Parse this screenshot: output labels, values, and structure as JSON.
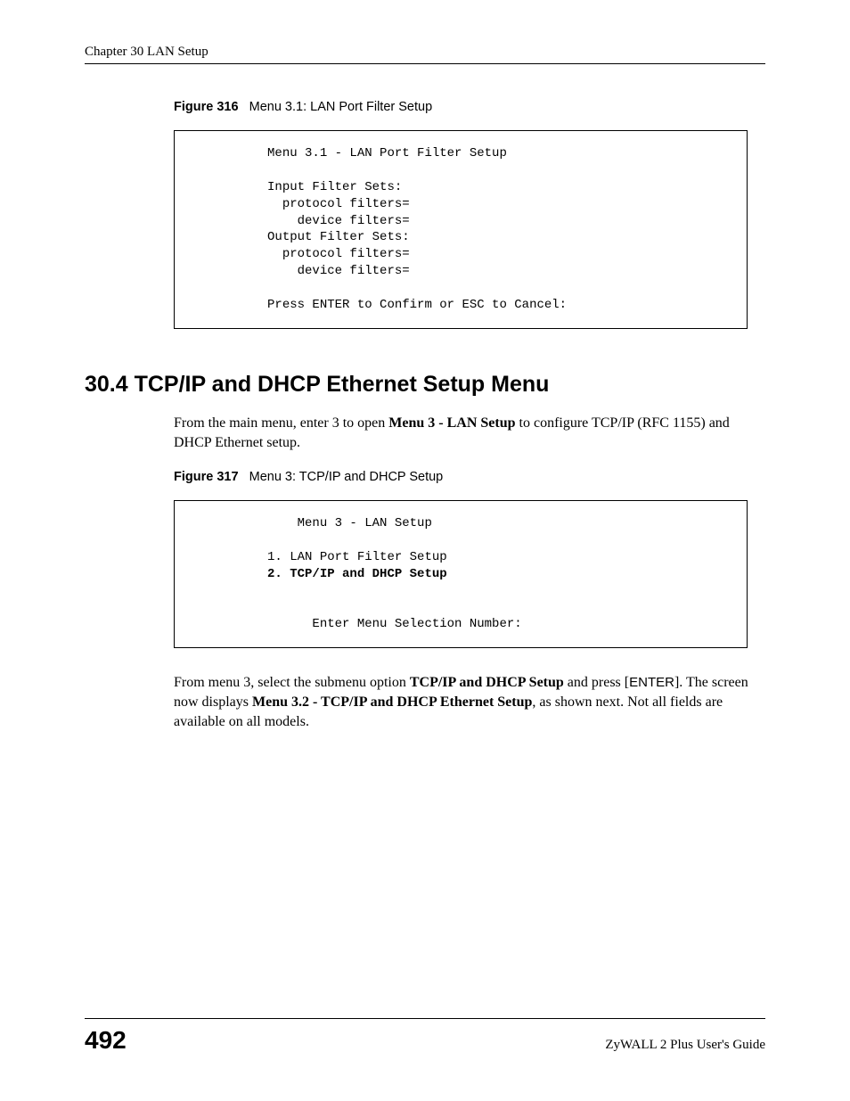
{
  "header": {
    "chapter_text": "Chapter 30 LAN Setup"
  },
  "figure316": {
    "label": "Figure 316",
    "caption": "Menu 3.1: LAN Port Filter Setup",
    "terminal": {
      "title": "Menu 3.1 - LAN Port Filter Setup",
      "line1": "Input Filter Sets:",
      "line2": "  protocol filters=",
      "line3": "    device filters=",
      "line4": "Output Filter Sets:",
      "line5": "  protocol filters=",
      "line6": "    device filters=",
      "prompt": "Press ENTER to Confirm or ESC to Cancel:"
    }
  },
  "section": {
    "heading": "30.4  TCP/IP and DHCP Ethernet Setup Menu",
    "para1_a": "From the main menu, enter 3 to open ",
    "para1_bold": "Menu 3 - LAN Setup",
    "para1_b": " to configure TCP/IP (RFC 1155) and DHCP Ethernet setup."
  },
  "figure317": {
    "label": "Figure 317",
    "caption": "Menu 3: TCP/IP and DHCP Setup",
    "terminal": {
      "title": "Menu 3 - LAN Setup",
      "item1": "1. LAN Port Filter Setup",
      "item2": "2. TCP/IP and DHCP Setup",
      "prompt": "Enter Menu Selection Number:"
    }
  },
  "para2": {
    "a": "From menu 3, select the submenu option ",
    "bold1": "TCP/IP and DHCP Setup",
    "b": " and press [",
    "enter": "ENTER",
    "c": "]. The screen now displays ",
    "bold2": "Menu 3.2 - TCP/IP and DHCP Ethernet Setup",
    "d": ", as shown next. Not all fields are available on all models."
  },
  "footer": {
    "page_number": "492",
    "guide": "ZyWALL 2 Plus User's Guide"
  }
}
